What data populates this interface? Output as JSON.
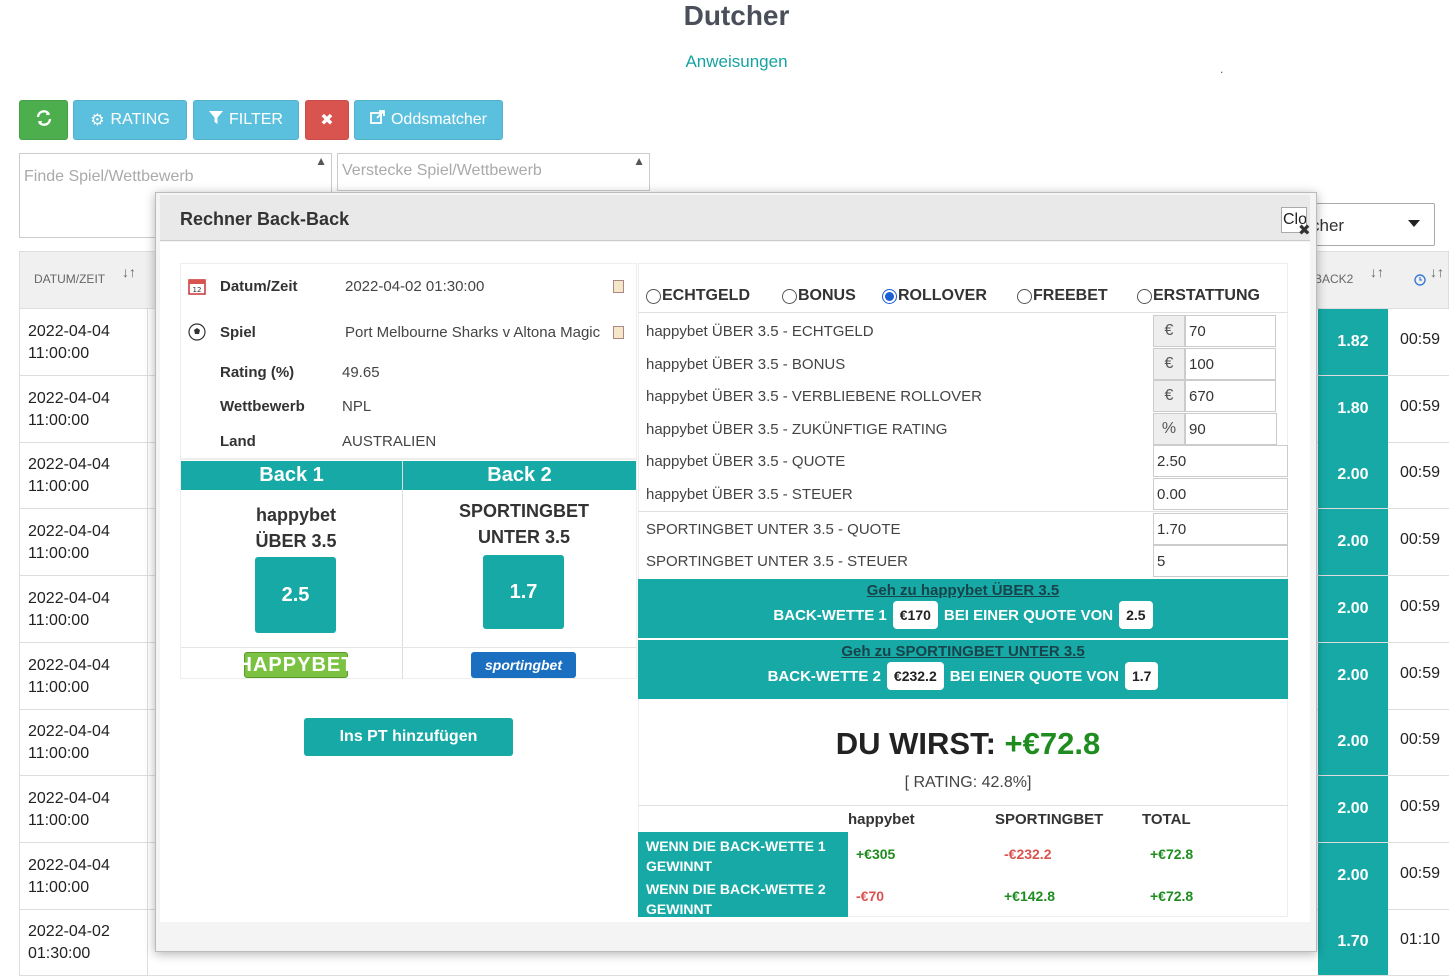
{
  "header": {
    "title": "Dutcher",
    "instructions": "Anweisungen",
    "dot": "."
  },
  "toolbar": {
    "rating_label": "RATING",
    "filter_label": "FILTER",
    "oddsmatcher_label": "Oddsmatcher"
  },
  "filters": {
    "find_placeholder": "Finde Spiel/Wettbewerb",
    "hide_placeholder": "Verstecke Spiel/Wettbewerb"
  },
  "right_select": {
    "value": "cher"
  },
  "table": {
    "headers": {
      "datetime": "DATUM/ZEIT",
      "back2": "BACK2",
      "sort": "↓↑"
    },
    "rows": [
      {
        "date": "2022-04-04",
        "time": "11:00:00",
        "back2": "1.82",
        "countdown": "00:59"
      },
      {
        "date": "2022-04-04",
        "time": "11:00:00",
        "back2": "1.80",
        "countdown": "00:59"
      },
      {
        "date": "2022-04-04",
        "time": "11:00:00",
        "back2": "2.00",
        "countdown": "00:59"
      },
      {
        "date": "2022-04-04",
        "time": "11:00:00",
        "back2": "2.00",
        "countdown": "00:59"
      },
      {
        "date": "2022-04-04",
        "time": "11:00:00",
        "back2": "2.00",
        "countdown": "00:59"
      },
      {
        "date": "2022-04-04",
        "time": "11:00:00",
        "back2": "2.00",
        "countdown": "00:59"
      },
      {
        "date": "2022-04-04",
        "time": "11:00:00",
        "back2": "2.00",
        "countdown": "00:59"
      },
      {
        "date": "2022-04-04",
        "time": "11:00:00",
        "back2": "2.00",
        "countdown": "00:59"
      },
      {
        "date": "2022-04-04",
        "time": "11:00:00",
        "back2": "2.00",
        "countdown": "00:59"
      },
      {
        "date": "2022-04-02",
        "time": "01:30:00",
        "back2": "1.70",
        "countdown": "01:10"
      }
    ]
  },
  "modal": {
    "title": "Rechner Back-Back",
    "close_label": "Close",
    "info": {
      "datetime_label": "Datum/Zeit",
      "datetime_value": "2022-04-02 01:30:00",
      "match_label": "Spiel",
      "match_value": "Port Melbourne Sharks v Altona Magic",
      "rating_label": "Rating (%)",
      "rating_value": "49.65",
      "competition_label": "Wettbewerb",
      "competition_value": "NPL",
      "country_label": "Land",
      "country_value": "AUSTRALIEN"
    },
    "back1": {
      "header": "Back 1",
      "bookmaker": "happybet",
      "market": "ÜBER 3.5",
      "odds": "2.5",
      "logo_text": "HAPPYBET"
    },
    "back2": {
      "header": "Back 2",
      "bookmaker": "SPORTINGBET",
      "market": "UNTER 3.5",
      "odds": "1.7",
      "logo_text": "sportingbet"
    },
    "add_button": "Ins PT hinzufügen",
    "modes": [
      "ECHTGELD",
      "BONUS",
      "ROLLOVER",
      "FREEBET",
      "ERSTATTUNG"
    ],
    "selected_mode": "ROLLOVER",
    "fields": [
      {
        "label": "happybet ÜBER 3.5 - ECHTGELD",
        "addon": "€",
        "value": "70"
      },
      {
        "label": "happybet ÜBER 3.5 - BONUS",
        "addon": "€",
        "value": "100"
      },
      {
        "label": "happybet ÜBER 3.5 - VERBLIEBENE ROLLOVER",
        "addon": "€",
        "value": "670"
      },
      {
        "label": "happybet ÜBER 3.5 - ZUKÜNFTIGE RATING",
        "addon": "%",
        "value": "90"
      },
      {
        "label": "happybet ÜBER 3.5 - QUOTE",
        "value": "2.50"
      },
      {
        "label": "happybet ÜBER 3.5 - STEUER",
        "value": "0.00"
      },
      {
        "label": "SPORTINGBET UNTER 3.5  - QUOTE",
        "value": "1.70"
      },
      {
        "label": "SPORTINGBET UNTER 3.5 - STEUER",
        "value": "5"
      }
    ],
    "bet1": {
      "link": "Geh zu happybet ÜBER 3.5",
      "prefix": "BACK-WETTE 1",
      "stake": "€170",
      "mid": "BEI EINER QUOTE VON",
      "odds": "2.5"
    },
    "bet2": {
      "link": "Geh zu SPORTINGBET UNTER 3.5",
      "prefix": "BACK-WETTE 2",
      "stake": "€232.2",
      "mid": "BEI EINER QUOTE VON",
      "odds": "1.7"
    },
    "result": {
      "label": "DU WIRST:",
      "value": "+€72.8",
      "rating": "[ RATING: 42.8%]"
    },
    "summary": {
      "headers": [
        "happybet",
        "SPORTINGBET",
        "TOTAL"
      ],
      "rows": [
        {
          "label": "WENN DIE BACK-WETTE 1 GEWINNT",
          "a": "+€305",
          "b": "-€232.2",
          "total": "+€72.8"
        },
        {
          "label": "WENN DIE BACK-WETTE 2 GEWINNT",
          "a": "-€70",
          "b": "+€142.8",
          "total": "+€72.8"
        }
      ]
    }
  }
}
